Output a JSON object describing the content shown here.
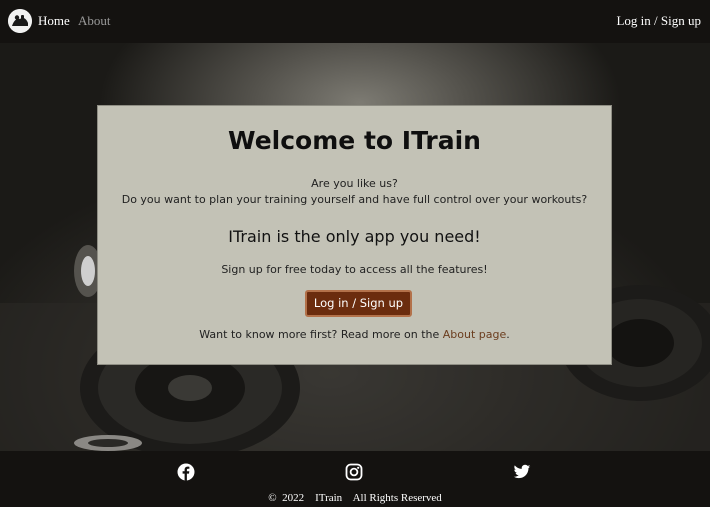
{
  "nav": {
    "logo_icon": "kettlebell-logo-icon",
    "home_label": "Home",
    "about_label": "About",
    "login_label": "Log in / Sign up"
  },
  "hero": {
    "background_description_icon": "dumbbell-background-image"
  },
  "card": {
    "title": "Welcome to ITrain",
    "line1": "Are you like us?",
    "line2": "Do you want to plan your training yourself and have full control over your workouts?",
    "subtitle": "ITrain is the only app you need!",
    "cta_text": "Sign up for free today to access all the features!",
    "button_label": "Log in / Sign up",
    "more_prefix": "Want to know more first? Read more on the ",
    "more_link": "About page",
    "more_suffix": "."
  },
  "footer": {
    "social": [
      {
        "name": "facebook-icon"
      },
      {
        "name": "instagram-icon"
      },
      {
        "name": "twitter-icon"
      }
    ],
    "copyright": "©  2022    ITrain    All Rights Reserved"
  },
  "colors": {
    "nav_bg": "#141210",
    "card_bg": "#c3c2b6",
    "button_bg": "#6b2c0e",
    "button_border": "#b3714a",
    "link": "#6b3d1e"
  }
}
